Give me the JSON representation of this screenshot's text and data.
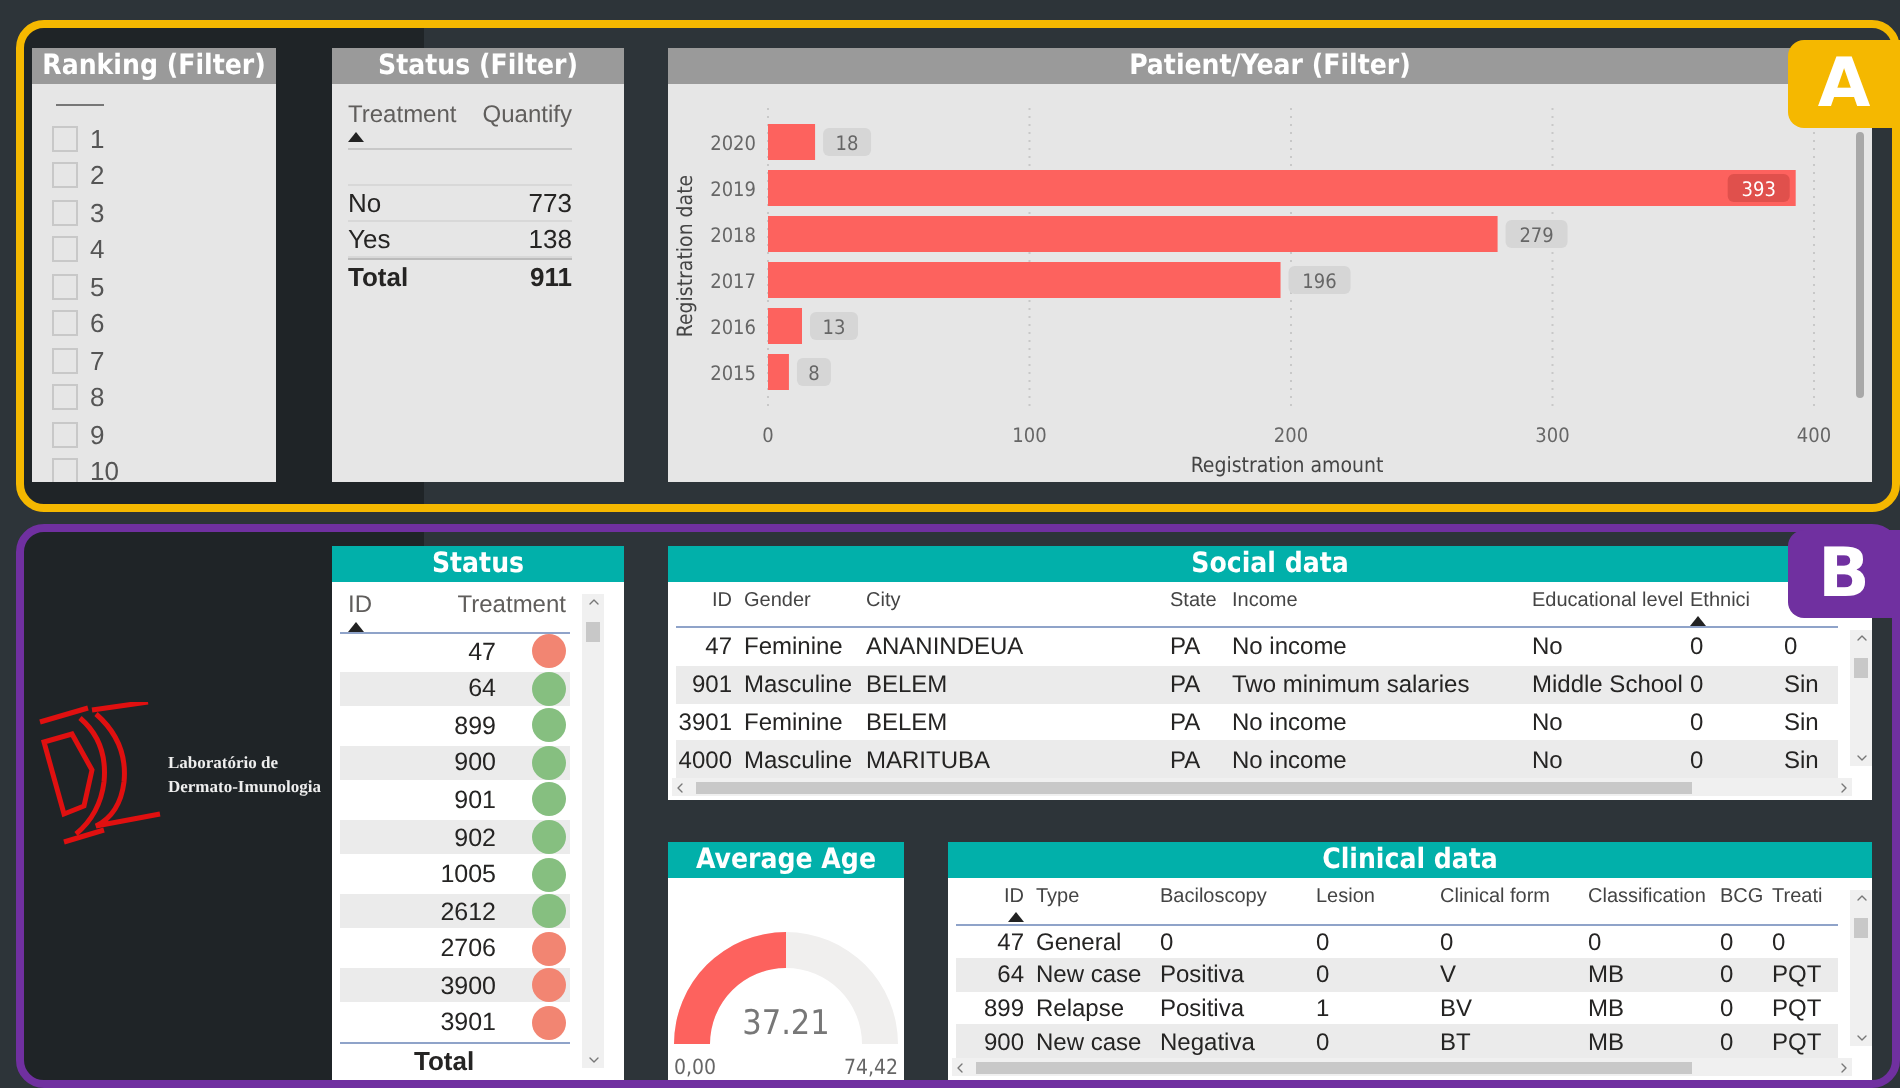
{
  "section_a": {
    "badge": "A",
    "ranking_filter": {
      "title": "Ranking (Filter)",
      "items": [
        {
          "label": "1",
          "checked": false
        },
        {
          "label": "2",
          "checked": false
        },
        {
          "label": "3",
          "checked": false
        },
        {
          "label": "4",
          "checked": false
        },
        {
          "label": "5",
          "checked": false
        },
        {
          "label": "6",
          "checked": false
        },
        {
          "label": "7",
          "checked": false
        },
        {
          "label": "8",
          "checked": false
        },
        {
          "label": "9",
          "checked": false
        },
        {
          "label": "10",
          "checked": false
        }
      ]
    },
    "status_filter": {
      "title": "Status (Filter)",
      "columns": [
        {
          "label": "Treatment",
          "sorted": true
        },
        {
          "label": "Quantify",
          "sorted": false
        }
      ],
      "rows": [
        [
          "No",
          "773"
        ],
        [
          "Yes",
          "138"
        ]
      ],
      "total": [
        "Total",
        "911"
      ]
    },
    "patient_year": {
      "title": "Patient/Year (Filter)",
      "chart_data": {
        "type": "bar",
        "orientation": "horizontal",
        "xlabel": "Registration amount",
        "ylabel": "Registration date",
        "categories": [
          "2020",
          "2019",
          "2018",
          "2017",
          "2016",
          "2015"
        ],
        "values": [
          18,
          393,
          279,
          196,
          13,
          8
        ],
        "xlim": [
          0,
          400
        ],
        "xticks": [
          0,
          100,
          200,
          300,
          400
        ],
        "grid": true,
        "data_labels": true
      }
    }
  },
  "section_b": {
    "badge": "B",
    "logo": {
      "lines": [
        "Laboratório de",
        "Dermato-Imunologia"
      ]
    },
    "status": {
      "title": "Status",
      "columns": [
        {
          "label": "ID",
          "sorted": true
        },
        {
          "label": "Treatment",
          "sorted": false
        }
      ],
      "rows": [
        {
          "id": "47",
          "color": "#f28572"
        },
        {
          "id": "64",
          "color": "#86bf80"
        },
        {
          "id": "899",
          "color": "#86bf80"
        },
        {
          "id": "900",
          "color": "#86bf80"
        },
        {
          "id": "901",
          "color": "#86bf80"
        },
        {
          "id": "902",
          "color": "#86bf80"
        },
        {
          "id": "1005",
          "color": "#86bf80"
        },
        {
          "id": "2612",
          "color": "#86bf80"
        },
        {
          "id": "2706",
          "color": "#f28572"
        },
        {
          "id": "3900",
          "color": "#f28572"
        },
        {
          "id": "3901",
          "color": "#f28572"
        }
      ],
      "total": "Total"
    },
    "social_data": {
      "title": "Social data",
      "columns": [
        {
          "label": "ID",
          "sorted": false
        },
        {
          "label": "Gender",
          "sorted": false
        },
        {
          "label": "City",
          "sorted": false
        },
        {
          "label": "State",
          "sorted": false
        },
        {
          "label": "Income",
          "sorted": false
        },
        {
          "label": "Educational level",
          "sorted": false
        },
        {
          "label": "Ethnici",
          "sorted": true
        }
      ],
      "rows": [
        [
          "47",
          "Feminine",
          "ANANINDEUA",
          "PA",
          "No income",
          "No",
          "0",
          "0"
        ],
        [
          "901",
          "Masculine",
          "BELEM",
          "PA",
          "Two minimum salaries",
          "Middle School",
          "0",
          "Sin"
        ],
        [
          "3901",
          "Feminine",
          "BELEM",
          "PA",
          "No income",
          "No",
          "0",
          "Sin"
        ],
        [
          "4000",
          "Masculine",
          "MARITUBA",
          "PA",
          "No income",
          "No",
          "0",
          "Sin"
        ]
      ]
    },
    "average_age": {
      "title": "Average Age",
      "value": "37.21",
      "min": "0,00",
      "max": "74,42"
    },
    "clinical_data": {
      "title": "Clinical data",
      "columns": [
        {
          "label": "ID",
          "sorted": true
        },
        {
          "label": "Type",
          "sorted": false
        },
        {
          "label": "Baciloscopy",
          "sorted": false
        },
        {
          "label": "Lesion",
          "sorted": false
        },
        {
          "label": "Clinical form",
          "sorted": false
        },
        {
          "label": "Classification",
          "sorted": false
        },
        {
          "label": "BCG",
          "sorted": false
        },
        {
          "label": "Treati",
          "sorted": false
        }
      ],
      "rows": [
        [
          "47",
          "General",
          "0",
          "0",
          "0",
          "0",
          "0",
          "0"
        ],
        [
          "64",
          "New case",
          "Positiva",
          "0",
          "V",
          "MB",
          "0",
          "PQT"
        ],
        [
          "899",
          "Relapse",
          "Positiva",
          "1",
          "BV",
          "MB",
          "0",
          "PQT"
        ],
        [
          "900",
          "New case",
          "Negativa",
          "0",
          "BT",
          "MB",
          "0",
          "PQT"
        ]
      ]
    }
  }
}
